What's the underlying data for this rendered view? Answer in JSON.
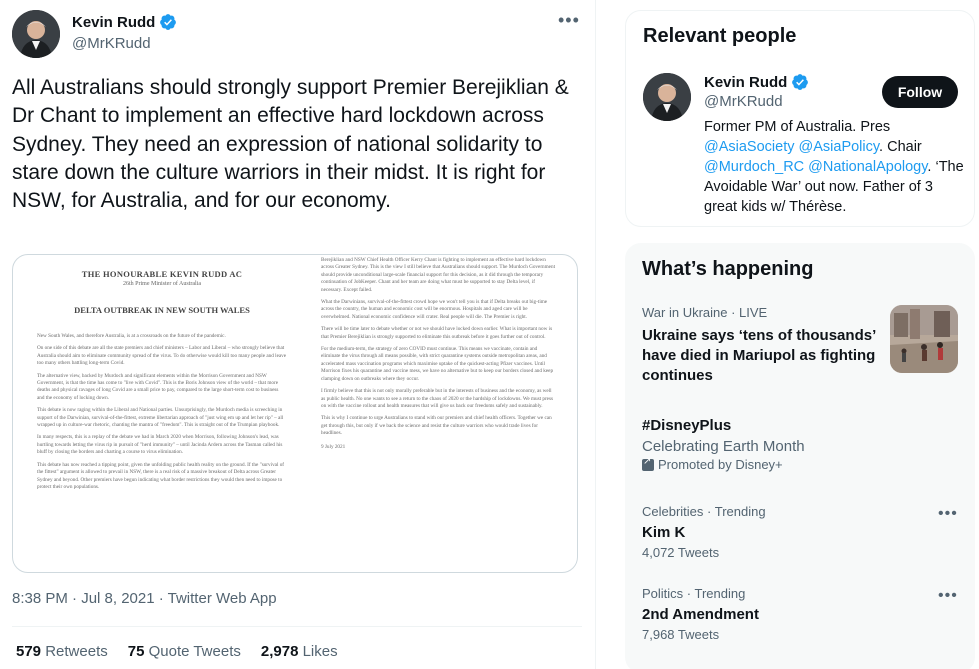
{
  "tweet": {
    "author": {
      "name": "Kevin Rudd",
      "handle": "@MrKRudd"
    },
    "text": "All Australians should strongly support Premier Berejiklian & Dr Chant to implement an effective hard lockdown across Sydney. They need an expression of national solidarity to stare down the culture warriors in their midst. It is right for NSW, for Australia, and for our economy.",
    "document": {
      "title": "THE HONOURABLE KEVIN RUDD AC",
      "subtitle": "26th Prime Minister of Australia",
      "heading": "DELTA OUTBREAK IN NEW SOUTH WALES",
      "left_paragraphs": [
        "New South Wales, and therefore Australia, is at a crossroads on the future of the pandemic.",
        "On one side of this debate are all the state premiers and chief ministers – Labor and Liberal – who strongly believe that Australia should aim to eliminate community spread of the virus. To do otherwise would kill too many people and leave too many others battling long-term Covid.",
        "The alternative view, backed by Murdoch and significant elements within the Morrison Government and NSW Government, is that the time has come to \"live with Covid\". This is the Boris Johnson view of the world – that more deaths and physical ravages of long Covid are a small price to pay, compared to the large short-term cost to business and the economy of locking down.",
        "This debate is now raging within the Liberal and National parties. Unsurprisingly, the Murdoch media is screeching in support of the Darwinian, survival-of-the-fittest, extreme libertarian approach of \"just wing em up and let her rip\" – all wrapped up in culture-war rhetoric, chanting the mantra of \"freedom\". This is straight out of the Trumpian playbook.",
        "In many respects, this is a replay of the debate we had in March 2020 when Morrison, following Johnson's lead, was hurtling towards letting the virus rip in pursuit of \"herd immunity\" – until Jacinda Ardern across the Tasman called his bluff by closing the borders and charting a course to virus elimination.",
        "This debate has now reached a tipping point, given the unfolding public health reality on the ground. If the \"survival of the fittest\" argument is allowed to prevail in NSW, there is a real risk of a massive breakout of Delta across Greater Sydney and beyond. Other premiers have begun indicating what border restrictions they would then need to impose to protect their own populations."
      ],
      "right_paragraphs": [
        "Berejiklian and NSW Chief Health Officer Kerry Chant is fighting to implement an effective hard lockdown across Greater Sydney. This is the view I still believe that Australians should support. The Murdoch Government should provide unconditional large-scale financial support for this decision, as it did through the temporary continuation of JobKeeper. Chant and her team are doing what must be supported to stay Delta level, if necessary. Except failed.",
        "What the Darwinians, survival-of-the-fittest crowd hope we won't tell you is that if Delta breaks out big-time across the country, the human and economic cost will be enormous. Hospitals and aged care will be overwhelmed. National economic confidence will crater. Real people will die. The Premier is right.",
        "There will be time later to debate whether or not we should have locked down earlier. What is important now is that Premier Berejiklian is strongly supported to eliminate this outbreak before it goes further out of control.",
        "For the medium-term, the strategy of zero COVID must continue. This means we vaccinate, contain and eliminate the virus through all means possible, with strict quarantine systems outside metropolitan areas, and accelerated mass vaccination programs which maximise uptake of the quickest-acting Pfizer vaccines. Until Morrison fixes his quarantine and vaccine mess, we have no alternative but to keep our borders closed and keep clamping down on outbreaks where they occur.",
        "I firmly believe that this is not only morally preferable but in the interests of business and the economy, as well as public health. No one wants to see a return to the chaos of 2020 or the hardship of lockdowns. We must press on with the vaccine rollout and health measures that will give us back our freedoms safely and sustainably.",
        "This is why I continue to urge Australians to stand with our premiers and chief health officers. Together we can get through this, but only if we back the science and resist the culture warriors who would trade lives for headlines."
      ],
      "date": "9 July 2021"
    },
    "timestamp": "8:38 PM · Jul 8, 2021 · Twitter Web App",
    "stats": [
      {
        "count": "579",
        "label": "Retweets"
      },
      {
        "count": "75",
        "label": "Quote Tweets"
      },
      {
        "count": "2,978",
        "label": "Likes"
      }
    ]
  },
  "relevant_people": {
    "title": "Relevant people",
    "name": "Kevin Rudd",
    "handle": "@MrKRudd",
    "follow_label": "Follow",
    "bio": {
      "part1": "Former PM of Australia. Pres ",
      "mention1": "@AsiaSociety",
      "mention2": "@AsiaPolicy",
      "part2": ". Chair ",
      "mention3": "@Murdoch_RC",
      "mention4": "@NationalApology",
      "part3": ". ‘The Avoidable War’ out now. Father of 3 great kids w/ Thérèse."
    }
  },
  "whats_happening": {
    "title": "What’s happening",
    "news": {
      "context": "War in Ukraine · LIVE",
      "headline": "Ukraine says ‘tens of thousands’ have died in Mariupol as fighting continues"
    },
    "promoted": {
      "title": "#DisneyPlus",
      "subtitle": "Celebrating Earth Month",
      "promoter": "Promoted by Disney+"
    },
    "trends": [
      {
        "context": "Celebrities · Trending",
        "title": "Kim K",
        "count": "4,072 Tweets"
      },
      {
        "context": "Politics · Trending",
        "title": "2nd Amendment",
        "count": "7,968 Tweets"
      }
    ]
  },
  "colors": {
    "accent": "#1d9bf0",
    "text": "#0f1419",
    "muted": "#536471",
    "follow_bg": "#0f1419"
  }
}
